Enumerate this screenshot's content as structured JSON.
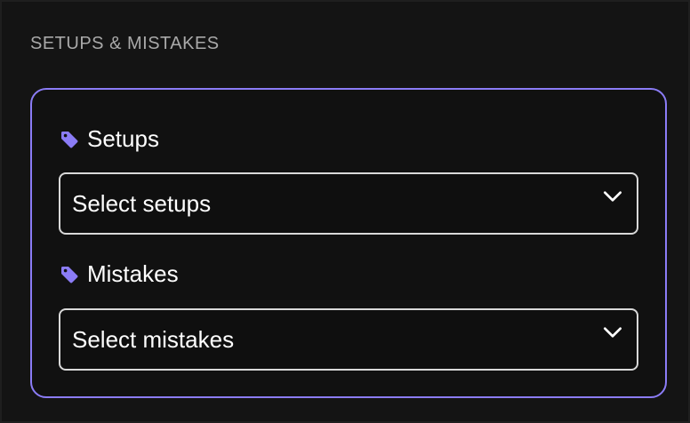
{
  "section": {
    "title": "SETUPS & MISTAKES"
  },
  "fields": {
    "setups": {
      "label": "Setups",
      "icon": "tag-icon",
      "select_value": "Select setups"
    },
    "mistakes": {
      "label": "Mistakes",
      "icon": "tag-icon",
      "select_value": "Select mistakes"
    }
  },
  "colors": {
    "accent": "#8b7cf6",
    "background": "#141414",
    "text": "#ffffff",
    "muted_text": "#a9a9a9",
    "field_border": "#d9d9d9"
  }
}
